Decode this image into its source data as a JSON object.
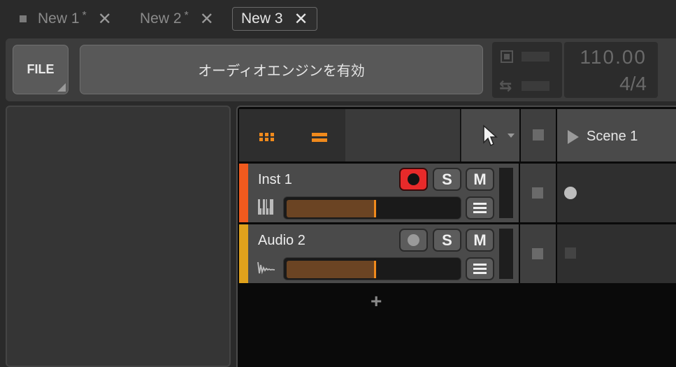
{
  "tabs": [
    {
      "label": "New 1",
      "modified": "*",
      "close": "✕"
    },
    {
      "label": "New 2",
      "modified": "*",
      "close": "✕"
    },
    {
      "label": "New 3",
      "modified": "",
      "close": "✕"
    }
  ],
  "header": {
    "file_label": "FILE",
    "engine_label": "オーディオエンジンを有効",
    "tempo": "110.00",
    "time_signature": "4/4"
  },
  "arranger": {
    "scene_label": "Scene 1",
    "add_track": "+"
  },
  "tracks": [
    {
      "name": "Inst 1",
      "color": "#f05a1e",
      "record_armed": true,
      "solo": "S",
      "mute": "M",
      "volume": 0.52,
      "clip": "circle"
    },
    {
      "name": "Audio 2",
      "color": "#e0a21c",
      "record_armed": false,
      "solo": "S",
      "mute": "M",
      "volume": 0.52,
      "clip": "empty"
    }
  ],
  "colors": {
    "accent": "#f08a1c",
    "record": "#e82a2a"
  },
  "icons": {
    "grid": "clip-launcher-grid-icon",
    "list": "arranger-list-icon",
    "pointer": "pointer-tool-icon",
    "play": "scene-play-icon",
    "piano": "instrument-track-icon",
    "waveform": "audio-track-icon",
    "cpu": "cpu-meter-icon",
    "io": "io-transfer-icon"
  }
}
